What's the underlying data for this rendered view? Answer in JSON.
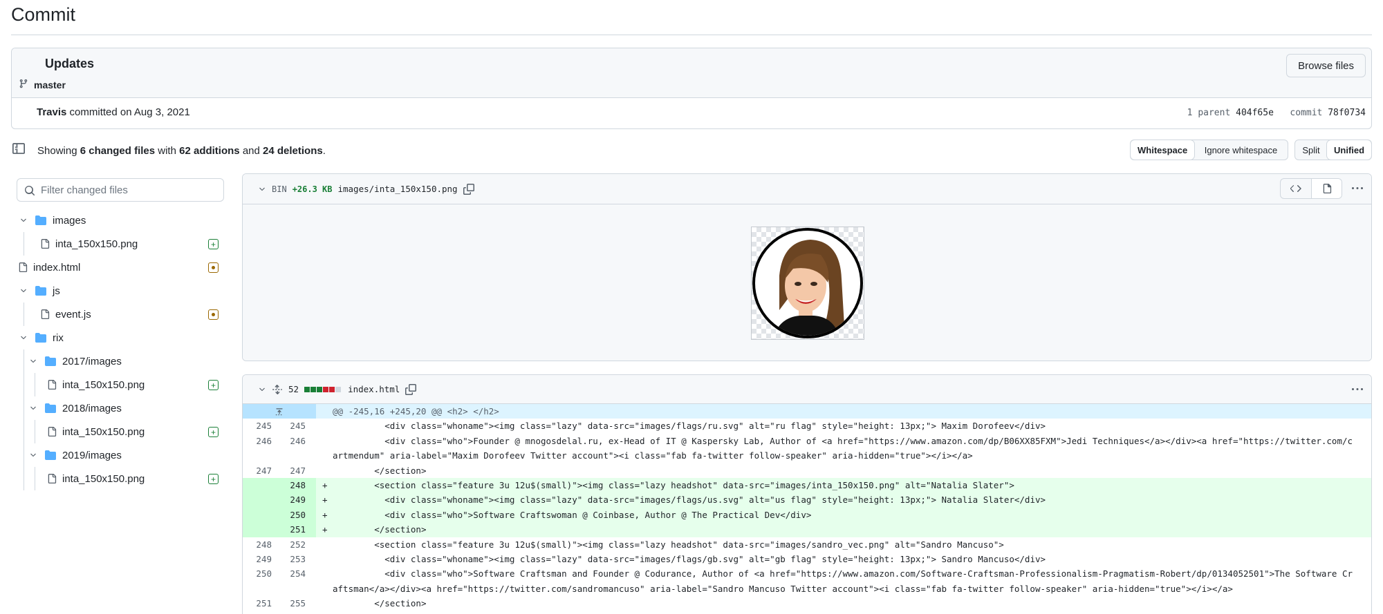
{
  "page": {
    "title": "Commit"
  },
  "commit": {
    "title": "Updates",
    "branch": "master",
    "browse_label": "Browse files",
    "author": "Travis",
    "committed_text": "committed on Aug 3, 2021",
    "parent_label": "1 parent",
    "parent_sha": "404f65e",
    "commit_label": "commit",
    "commit_sha": "78f0734"
  },
  "summary": {
    "showing": "Showing",
    "changed": "6 changed files",
    "with": "with",
    "additions": "62 additions",
    "and": "and",
    "deletions": "24 deletions",
    "period": "."
  },
  "toolbar": {
    "whitespace": "Whitespace",
    "ignore_whitespace": "Ignore whitespace",
    "split": "Split",
    "unified": "Unified"
  },
  "sidebar": {
    "filter_placeholder": "Filter changed files",
    "items": [
      {
        "label": "images"
      },
      {
        "label": "inta_150x150.png"
      },
      {
        "label": "index.html"
      },
      {
        "label": "js"
      },
      {
        "label": "event.js"
      },
      {
        "label": "rix"
      },
      {
        "label": "2017/images"
      },
      {
        "label": "inta_150x150.png"
      },
      {
        "label": "2018/images"
      },
      {
        "label": "inta_150x150.png"
      },
      {
        "label": "2019/images"
      },
      {
        "label": "inta_150x150.png"
      }
    ]
  },
  "file1": {
    "bin_label": "BIN",
    "size": "+26.3 KB",
    "name": "images/inta_150x150.png"
  },
  "file2": {
    "count": "52",
    "name": "index.html",
    "stat_colors": [
      "#1a7f37",
      "#1a7f37",
      "#1a7f37",
      "#cf222e",
      "#cf222e",
      "#d0d7de"
    ]
  },
  "diff": {
    "hunk": "@@ -245,16 +245,20 @@ <h2> </h2>",
    "lines": [
      {
        "old": "245",
        "new": "245",
        "sign": "",
        "code": "          <div class=\"whoname\"><img class=\"lazy\" data-src=\"images/flags/ru.svg\" alt=\"ru flag\" style=\"height: 13px;\"> Maxim Dorofeev</div>"
      },
      {
        "old": "246",
        "new": "246",
        "sign": "",
        "code": "          <div class=\"who\">Founder @ mnogosdelal.ru, ex-Head of IT @ Kaspersky Lab, Author of <a href=\"https://www.amazon.com/dp/B06XX85FXM\">Jedi Techniques</a></div><a href=\"https://twitter.com/cartmendum\" aria-label=\"Maxim Dorofeev Twitter account\"><i class=\"fab fa-twitter follow-speaker\" aria-hidden=\"true\"></i></a>"
      },
      {
        "old": "247",
        "new": "247",
        "sign": "",
        "code": "        </section>"
      },
      {
        "old": "",
        "new": "248",
        "sign": "+",
        "code": "        <section class=\"feature 3u 12u$(small)\"><img class=\"lazy headshot\" data-src=\"images/inta_150x150.png\" alt=\"Natalia Slater\">"
      },
      {
        "old": "",
        "new": "249",
        "sign": "+",
        "code": "          <div class=\"whoname\"><img class=\"lazy\" data-src=\"images/flags/us.svg\" alt=\"us flag\" style=\"height: 13px;\"> Natalia Slater</div>"
      },
      {
        "old": "",
        "new": "250",
        "sign": "+",
        "code": "          <div class=\"who\">Software Craftswoman @ Coinbase, Author @ The Practical Dev</div>"
      },
      {
        "old": "",
        "new": "251",
        "sign": "+",
        "code": "        </section>"
      },
      {
        "old": "248",
        "new": "252",
        "sign": "",
        "code": "        <section class=\"feature 3u 12u$(small)\"><img class=\"lazy headshot\" data-src=\"images/sandro_vec.png\" alt=\"Sandro Mancuso\">"
      },
      {
        "old": "249",
        "new": "253",
        "sign": "",
        "code": "          <div class=\"whoname\"><img class=\"lazy\" data-src=\"images/flags/gb.svg\" alt=\"gb flag\" style=\"height: 13px;\"> Sandro Mancuso</div>"
      },
      {
        "old": "250",
        "new": "254",
        "sign": "",
        "code": "          <div class=\"who\">Software Craftsman and Founder @ Codurance, Author of <a href=\"https://www.amazon.com/Software-Craftsman-Professionalism-Pragmatism-Robert/dp/0134052501\">The Software Craftsman</a></div><a href=\"https://twitter.com/sandromancuso\" aria-label=\"Sandro Mancuso Twitter account\"><i class=\"fab fa-twitter follow-speaker\" aria-hidden=\"true\"></i></a>"
      },
      {
        "old": "251",
        "new": "255",
        "sign": "",
        "code": "        </section>"
      }
    ]
  }
}
